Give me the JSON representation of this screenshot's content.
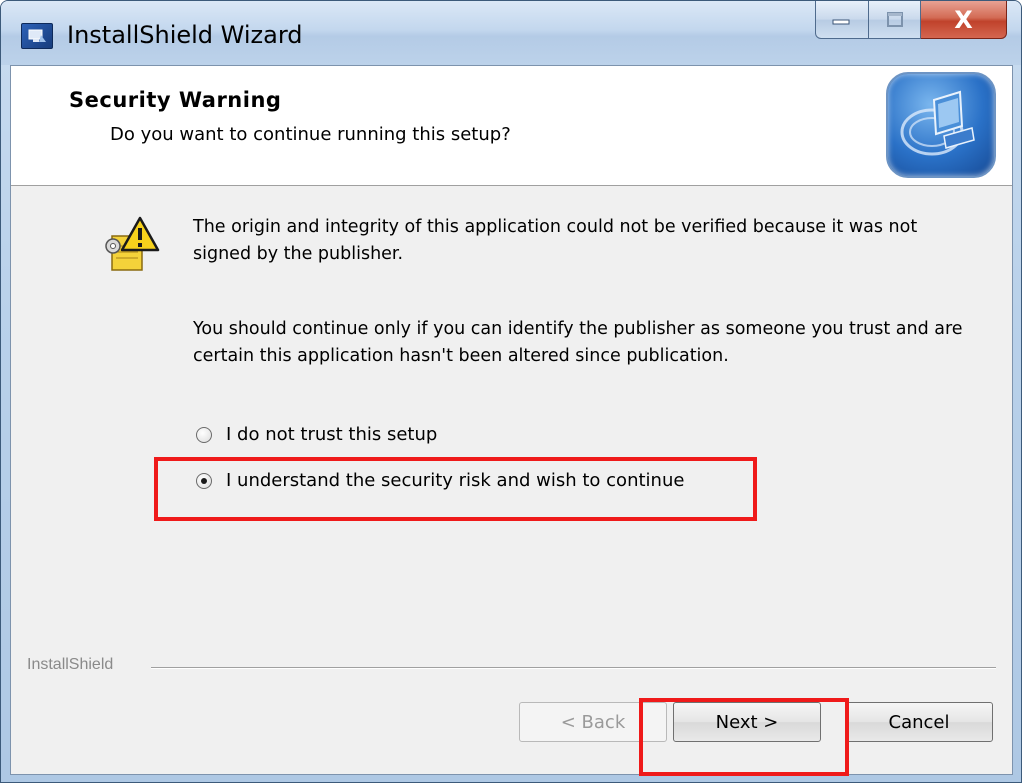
{
  "window": {
    "title": "InstallShield Wizard",
    "close_glyph": "X"
  },
  "header": {
    "title": "Security Warning",
    "subtitle": "Do you want to continue running this setup?",
    "logo_icon": "installshield-computer-icon"
  },
  "body": {
    "warning_icon": "security-warning-key-icon",
    "paragraph1": "The origin and integrity of this application could not be verified because it was not signed by the publisher.",
    "paragraph2": "You should continue only if you can identify the publisher as someone you trust and are certain this application hasn't been altered since publication."
  },
  "options": [
    {
      "label": "I do not trust this setup",
      "selected": false
    },
    {
      "label": "I understand the security risk and wish to continue",
      "selected": true
    }
  ],
  "footer": {
    "brand": "InstallShield",
    "back_label": "< Back",
    "next_label": "Next >",
    "cancel_label": "Cancel"
  },
  "colors": {
    "highlight": "#ef1a1a",
    "close_button": "#c0422b"
  }
}
